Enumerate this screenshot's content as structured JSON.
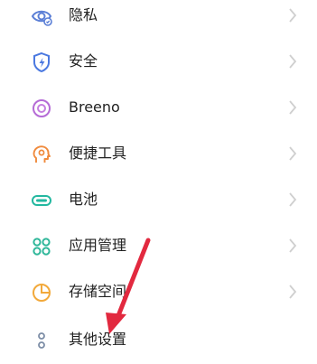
{
  "settings": {
    "items": [
      {
        "label": "隐私",
        "icon": "privacy-eye-icon",
        "icon_color": "#5B7FD6"
      },
      {
        "label": "安全",
        "icon": "security-shield-icon",
        "icon_color": "#4A78E0"
      },
      {
        "label": "Breeno",
        "icon": "breeno-circle-icon",
        "icon_color": "#B56BD6"
      },
      {
        "label": "便捷工具",
        "icon": "convenience-tools-icon",
        "icon_color": "#F08A3C"
      },
      {
        "label": "电池",
        "icon": "battery-icon",
        "icon_color": "#23B8A0"
      },
      {
        "label": "应用管理",
        "icon": "app-management-icon",
        "icon_color": "#2FB79A"
      },
      {
        "label": "存储空间",
        "icon": "storage-pie-icon",
        "icon_color": "#F2A93B"
      },
      {
        "label": "其他设置",
        "icon": "other-settings-icon",
        "icon_color": "#7C8DA6"
      }
    ]
  },
  "colors": {
    "chevron": "#CFCFCF",
    "annotation_arrow": "#E2293F"
  }
}
